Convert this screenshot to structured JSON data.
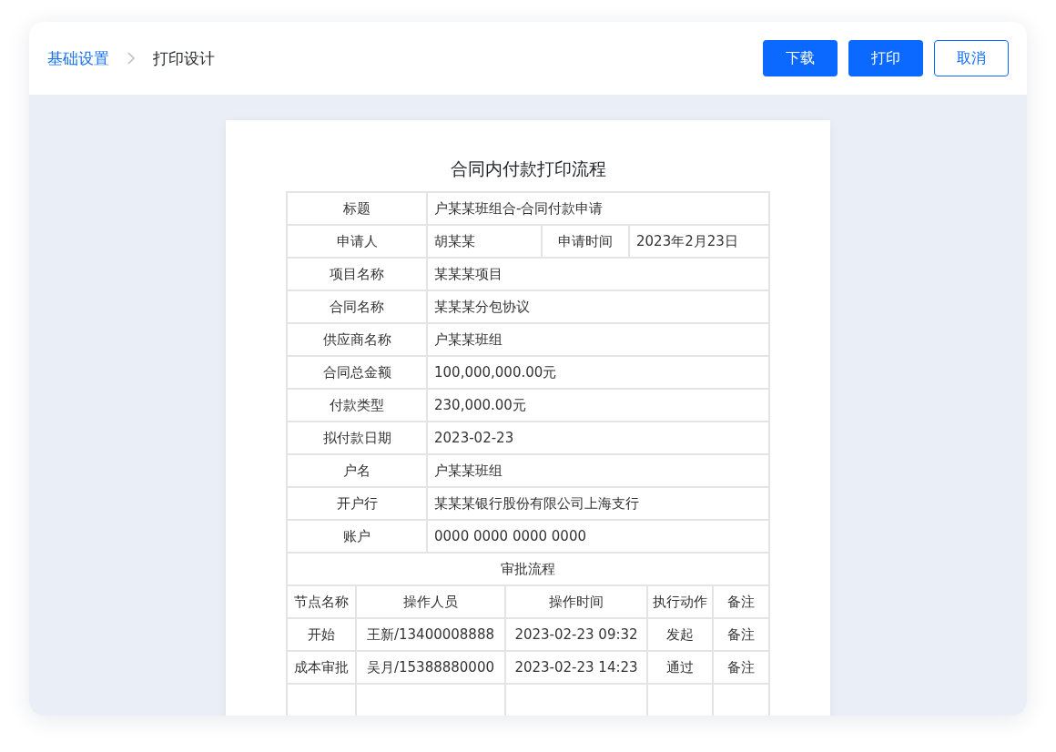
{
  "breadcrumb": [
    {
      "label": "基础设置",
      "kind": "link"
    },
    {
      "label": "打印设计",
      "kind": "current"
    }
  ],
  "buttons": [
    {
      "label": "下载",
      "kind": "primary"
    },
    {
      "label": "打印",
      "kind": "primary"
    },
    {
      "label": "取消",
      "kind": "outline"
    }
  ],
  "document": {
    "title": "合同内付款打印流程",
    "fields": [
      {
        "label": "标题",
        "value": "户某某班组合-合同付款申请"
      },
      {
        "label": "申请人",
        "value": "胡某某",
        "extra_label": "申请时间",
        "extra_value": "2023年2月23日"
      },
      {
        "label": "项目名称",
        "value": "某某某项目"
      },
      {
        "label": "合同名称",
        "value": "某某某分包协议"
      },
      {
        "label": "供应商名称",
        "value": "户某某班组"
      },
      {
        "label": "合同总金额",
        "value": "100,000,000.00元"
      },
      {
        "label": "付款类型",
        "value": "230,000.00元"
      },
      {
        "label": "拟付款日期",
        "value": "2023-02-23"
      },
      {
        "label": "户名",
        "value": "户某某班组"
      },
      {
        "label": "开户行",
        "value": "某某某银行股份有限公司上海支行"
      },
      {
        "label": "账户",
        "value": "0000 0000 0000 0000"
      }
    ],
    "section_title": "审批流程",
    "approval": {
      "columns": [
        "节点名称",
        "操作人员",
        "操作时间",
        "执行动作",
        "备注"
      ],
      "rows": [
        [
          "开始",
          "王新/13400008888",
          "2023-02-23 09:32",
          "发起",
          "备注"
        ],
        [
          "成本审批",
          "吴月/15388880000",
          "2023-02-23 14:23",
          "通过",
          "备注"
        ]
      ]
    }
  }
}
